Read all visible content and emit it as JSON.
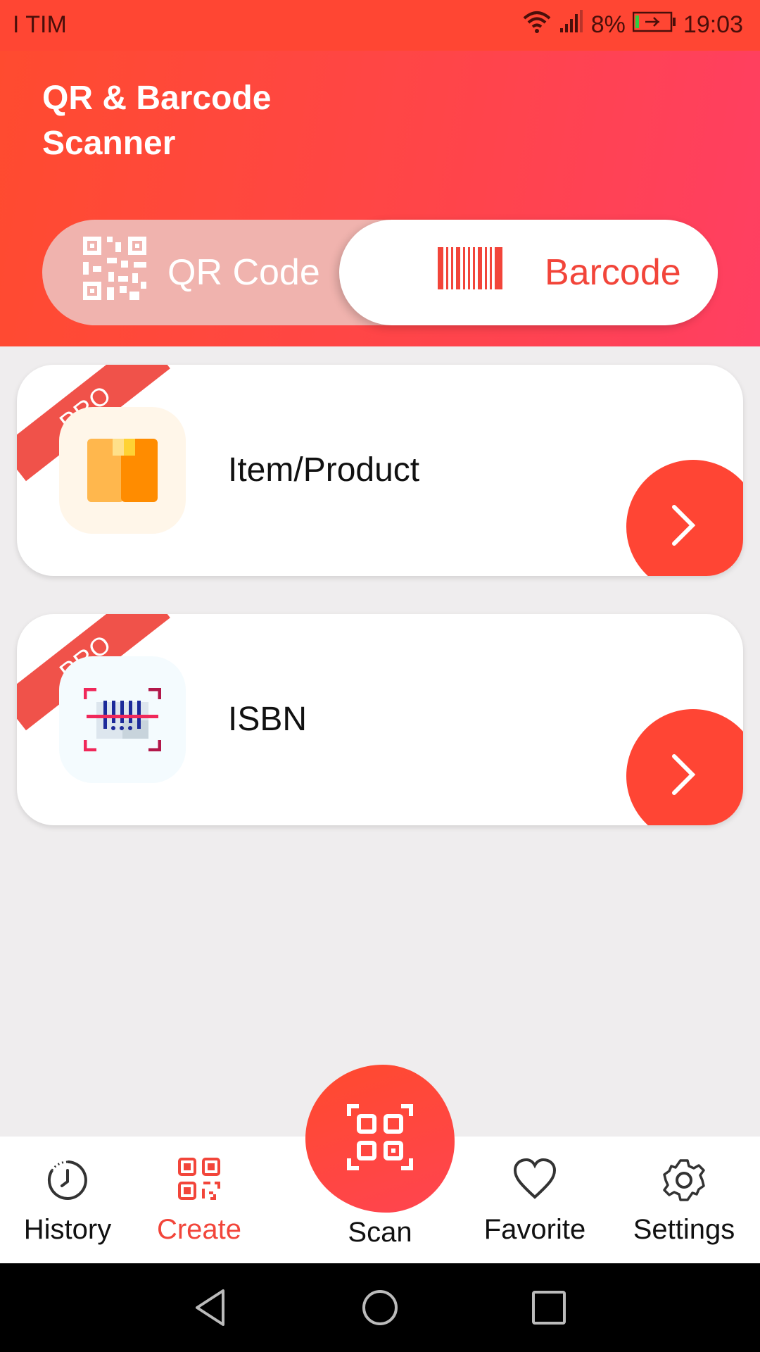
{
  "status_bar": {
    "carrier": "I TIM",
    "battery_percent": "8%",
    "time": "19:03",
    "icons": [
      "wifi-icon",
      "signal-icon",
      "battery-charging-icon"
    ]
  },
  "header": {
    "title": "QR & Barcode Scanner"
  },
  "toggle": {
    "options": [
      {
        "label": "QR Code",
        "icon": "qr-code-icon",
        "selected": false
      },
      {
        "label": "Barcode",
        "icon": "barcode-icon",
        "selected": true
      }
    ]
  },
  "cards": [
    {
      "badge": "PRO",
      "label": "Item/Product",
      "icon": "package-box-icon"
    },
    {
      "badge": "PRO",
      "label": "ISBN",
      "icon": "barcode-scan-icon"
    }
  ],
  "bottom_nav": {
    "items": [
      {
        "label": "History",
        "icon": "clock-icon",
        "active": false
      },
      {
        "label": "Create",
        "icon": "qr-create-icon",
        "active": true
      },
      {
        "label": "Scan",
        "icon": "scan-icon",
        "active": false
      },
      {
        "label": "Favorite",
        "icon": "heart-icon",
        "active": false
      },
      {
        "label": "Settings",
        "icon": "gear-icon",
        "active": false
      }
    ]
  },
  "colors": {
    "accent": "#ff4534",
    "accent_text": "#f2453a",
    "pro_ribbon": "#f0524a"
  }
}
